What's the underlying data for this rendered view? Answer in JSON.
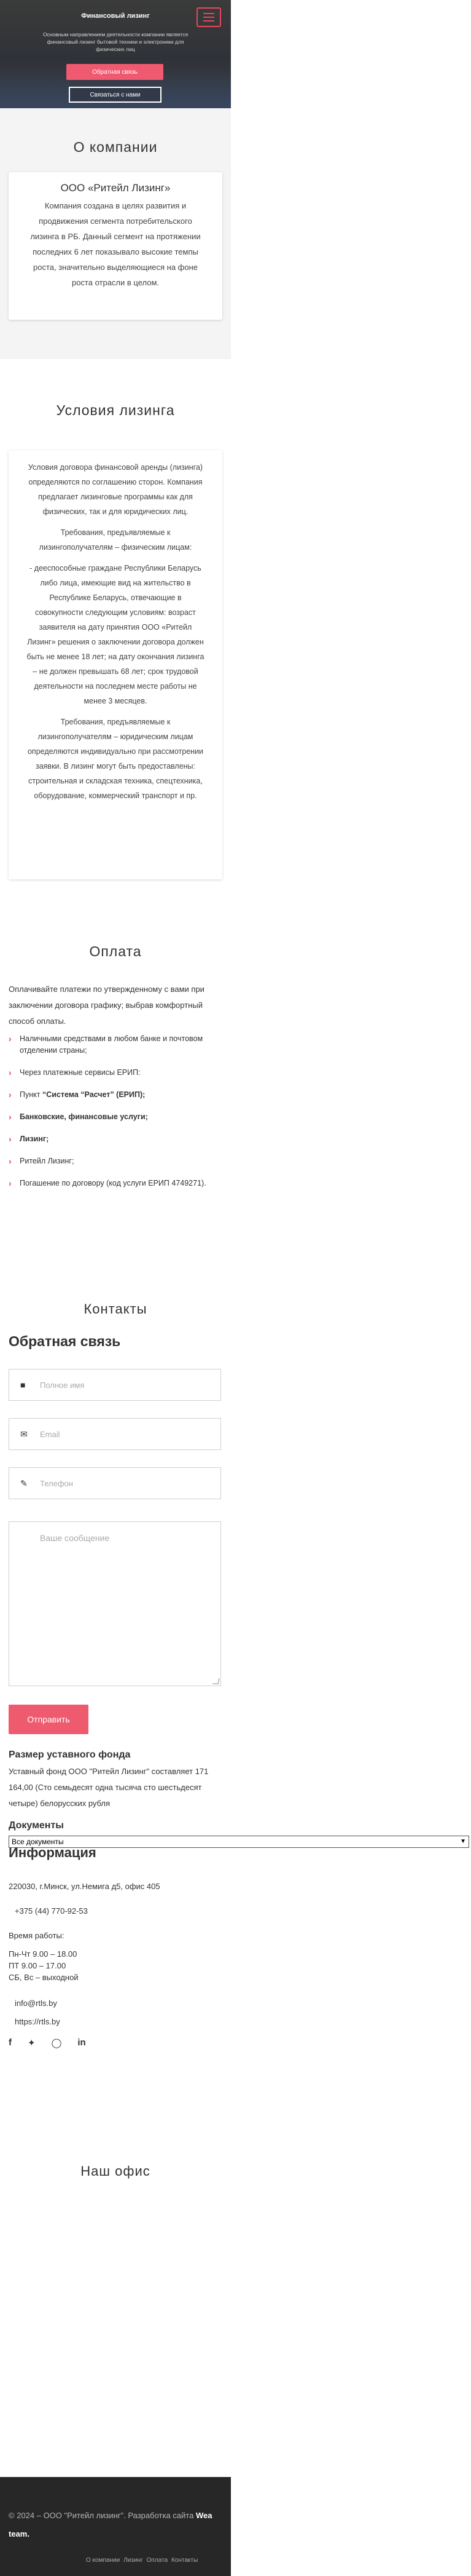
{
  "hero": {
    "title": "Финансовый лизинг",
    "subtitle": "Основным направлением деятельности компании является финансовый лизинг бытовой техники и электроники для физических лиц",
    "primary_button": "Обратная связь",
    "secondary_button": "Связаться с нами"
  },
  "about": {
    "heading": "О компании",
    "company": "ООО «Ритейл Лизинг»",
    "text": "Компания создана в целях развития и продвижения сегмента потребительского лизинга в РБ. Данный сегмент на протяжении последних 6 лет показывало высокие темпы роста, значительно выделяющиеся на фоне роста отрасли в целом."
  },
  "terms": {
    "heading": "Условия лизинга",
    "paragraphs": [
      "Условия договора финансовой аренды (лизинга) определяются по соглашению сторон. Компания предлагает лизинговые программы как для физических, так и для юридических лиц.",
      "Требования, предъявляемые к лизингополучателям – физическим лицам:",
      "- дееспособные граждане Республики Беларусь либо лица, имеющие вид на жительство в Республике Беларусь, отвечающие в совокупности следующим условиям: возраст заявителя на дату принятия ООО «Ритейл Лизинг» решения о заключении договора должен быть не менее 18 лет; на дату окончания лизинга – не должен превышать 68 лет; срок трудовой деятельности на последнем месте работы не менее 3 месяцев.",
      "Требования, предъявляемые к лизингополучателям – юридическим лицам определяются индивидуально при рассмотрении заявки. В лизинг могут быть предоставлены: строительная и складская техника, спецтехника, оборудование, коммерческий транспорт и пр."
    ]
  },
  "payment": {
    "heading": "Оплата",
    "intro": "Оплачивайте платежи по утвержденному с вами при заключении договора графику; выбрав комфортный способ оплаты.",
    "items": [
      {
        "text": "Наличными средствами в любом банке и почтовом отделении страны;"
      },
      {
        "text": "Через платежные сервисы ЕРИП:"
      },
      {
        "prefix": "Пункт ",
        "bold": "“Система “Расчет” (ЕРИП);"
      },
      {
        "bold": "Банковские, финансовые услуги;"
      },
      {
        "bold": "Лизинг;"
      },
      {
        "text": "Ритейл Лизинг;"
      },
      {
        "text": "Погашение по договору (код услуги ЕРИП 4749271)."
      }
    ]
  },
  "contacts": {
    "heading": "Контакты",
    "feedback_heading": "Обратная связь",
    "name_placeholder": "Полное имя",
    "email_placeholder": "Email",
    "phone_placeholder": "Телефон",
    "message_placeholder": "Ваше сообщение",
    "send_button": "Отправить"
  },
  "fund": {
    "heading": "Размер уставного фонда",
    "text": "Уставный фонд ООО \"Ритейл Лизинг\" составляет 171 164,00 (Сто семьдесят одна тысяча сто шестьдесят четыре) белорусских рубля"
  },
  "documents": {
    "heading": "Документы",
    "selected": "Все документы"
  },
  "info": {
    "heading": "Информация",
    "address": "220030, г.Минск, ул.Немига д5, офис 405",
    "phone": "+375 (44) 770-92-53",
    "hours_label": "Время работы:",
    "hours": [
      "Пн-Чт 9.00 – 18.00",
      "ПТ 9.00 – 17.00",
      "СБ, Вс – выходной"
    ],
    "email": "info@rtls.by",
    "site": "https://rtls.by"
  },
  "office": {
    "heading": "Наш офис"
  },
  "footer": {
    "copyright": "© 2024 – ООО \"Ритейл лизинг\". Разработка сайта",
    "developer": "Wea team.",
    "nav": [
      "О компании",
      "Лизинг",
      "Оплата",
      "Контакты"
    ]
  },
  "colors": {
    "accent": "#e8465a",
    "footer_bg": "#272727",
    "hero_bg": "#333333"
  },
  "icons": [
    "menu-icon",
    "user-icon",
    "envelope-icon",
    "edit-icon",
    "facebook-icon",
    "twitter-icon",
    "instagram-icon",
    "linkedin-icon",
    "chevron-right-icon"
  ]
}
